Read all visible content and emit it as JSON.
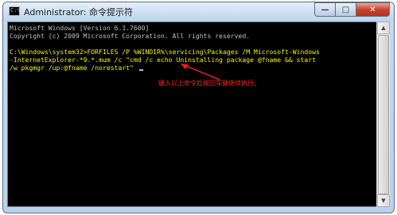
{
  "window": {
    "title": "Administrator: 命令提示符",
    "icon_text": "C:\\"
  },
  "controls": {
    "minimize": "—",
    "maximize": "□",
    "close": "✕"
  },
  "console": {
    "lines": [
      "Microsoft Windows [Version 6.1.7600]",
      "Copyright (c) 2009 Microsoft Corporation. All rights reserved.",
      "",
      "C:\\Windows\\system32>FORFILES /P %WINDIR%\\servicing\\Packages /M Microsoft-Windows",
      "-InternetExplorer-*9.*.mum /c \"cmd /c echo Uninstalling package @fname && start",
      "/w pkgmgr /up:@fname /norestart\" "
    ]
  },
  "annotation": {
    "text": "键入以上命令后按回车键继续执行。",
    "color": "#ff2020"
  },
  "scrollbar": {
    "up": "▲",
    "down": "▼"
  }
}
